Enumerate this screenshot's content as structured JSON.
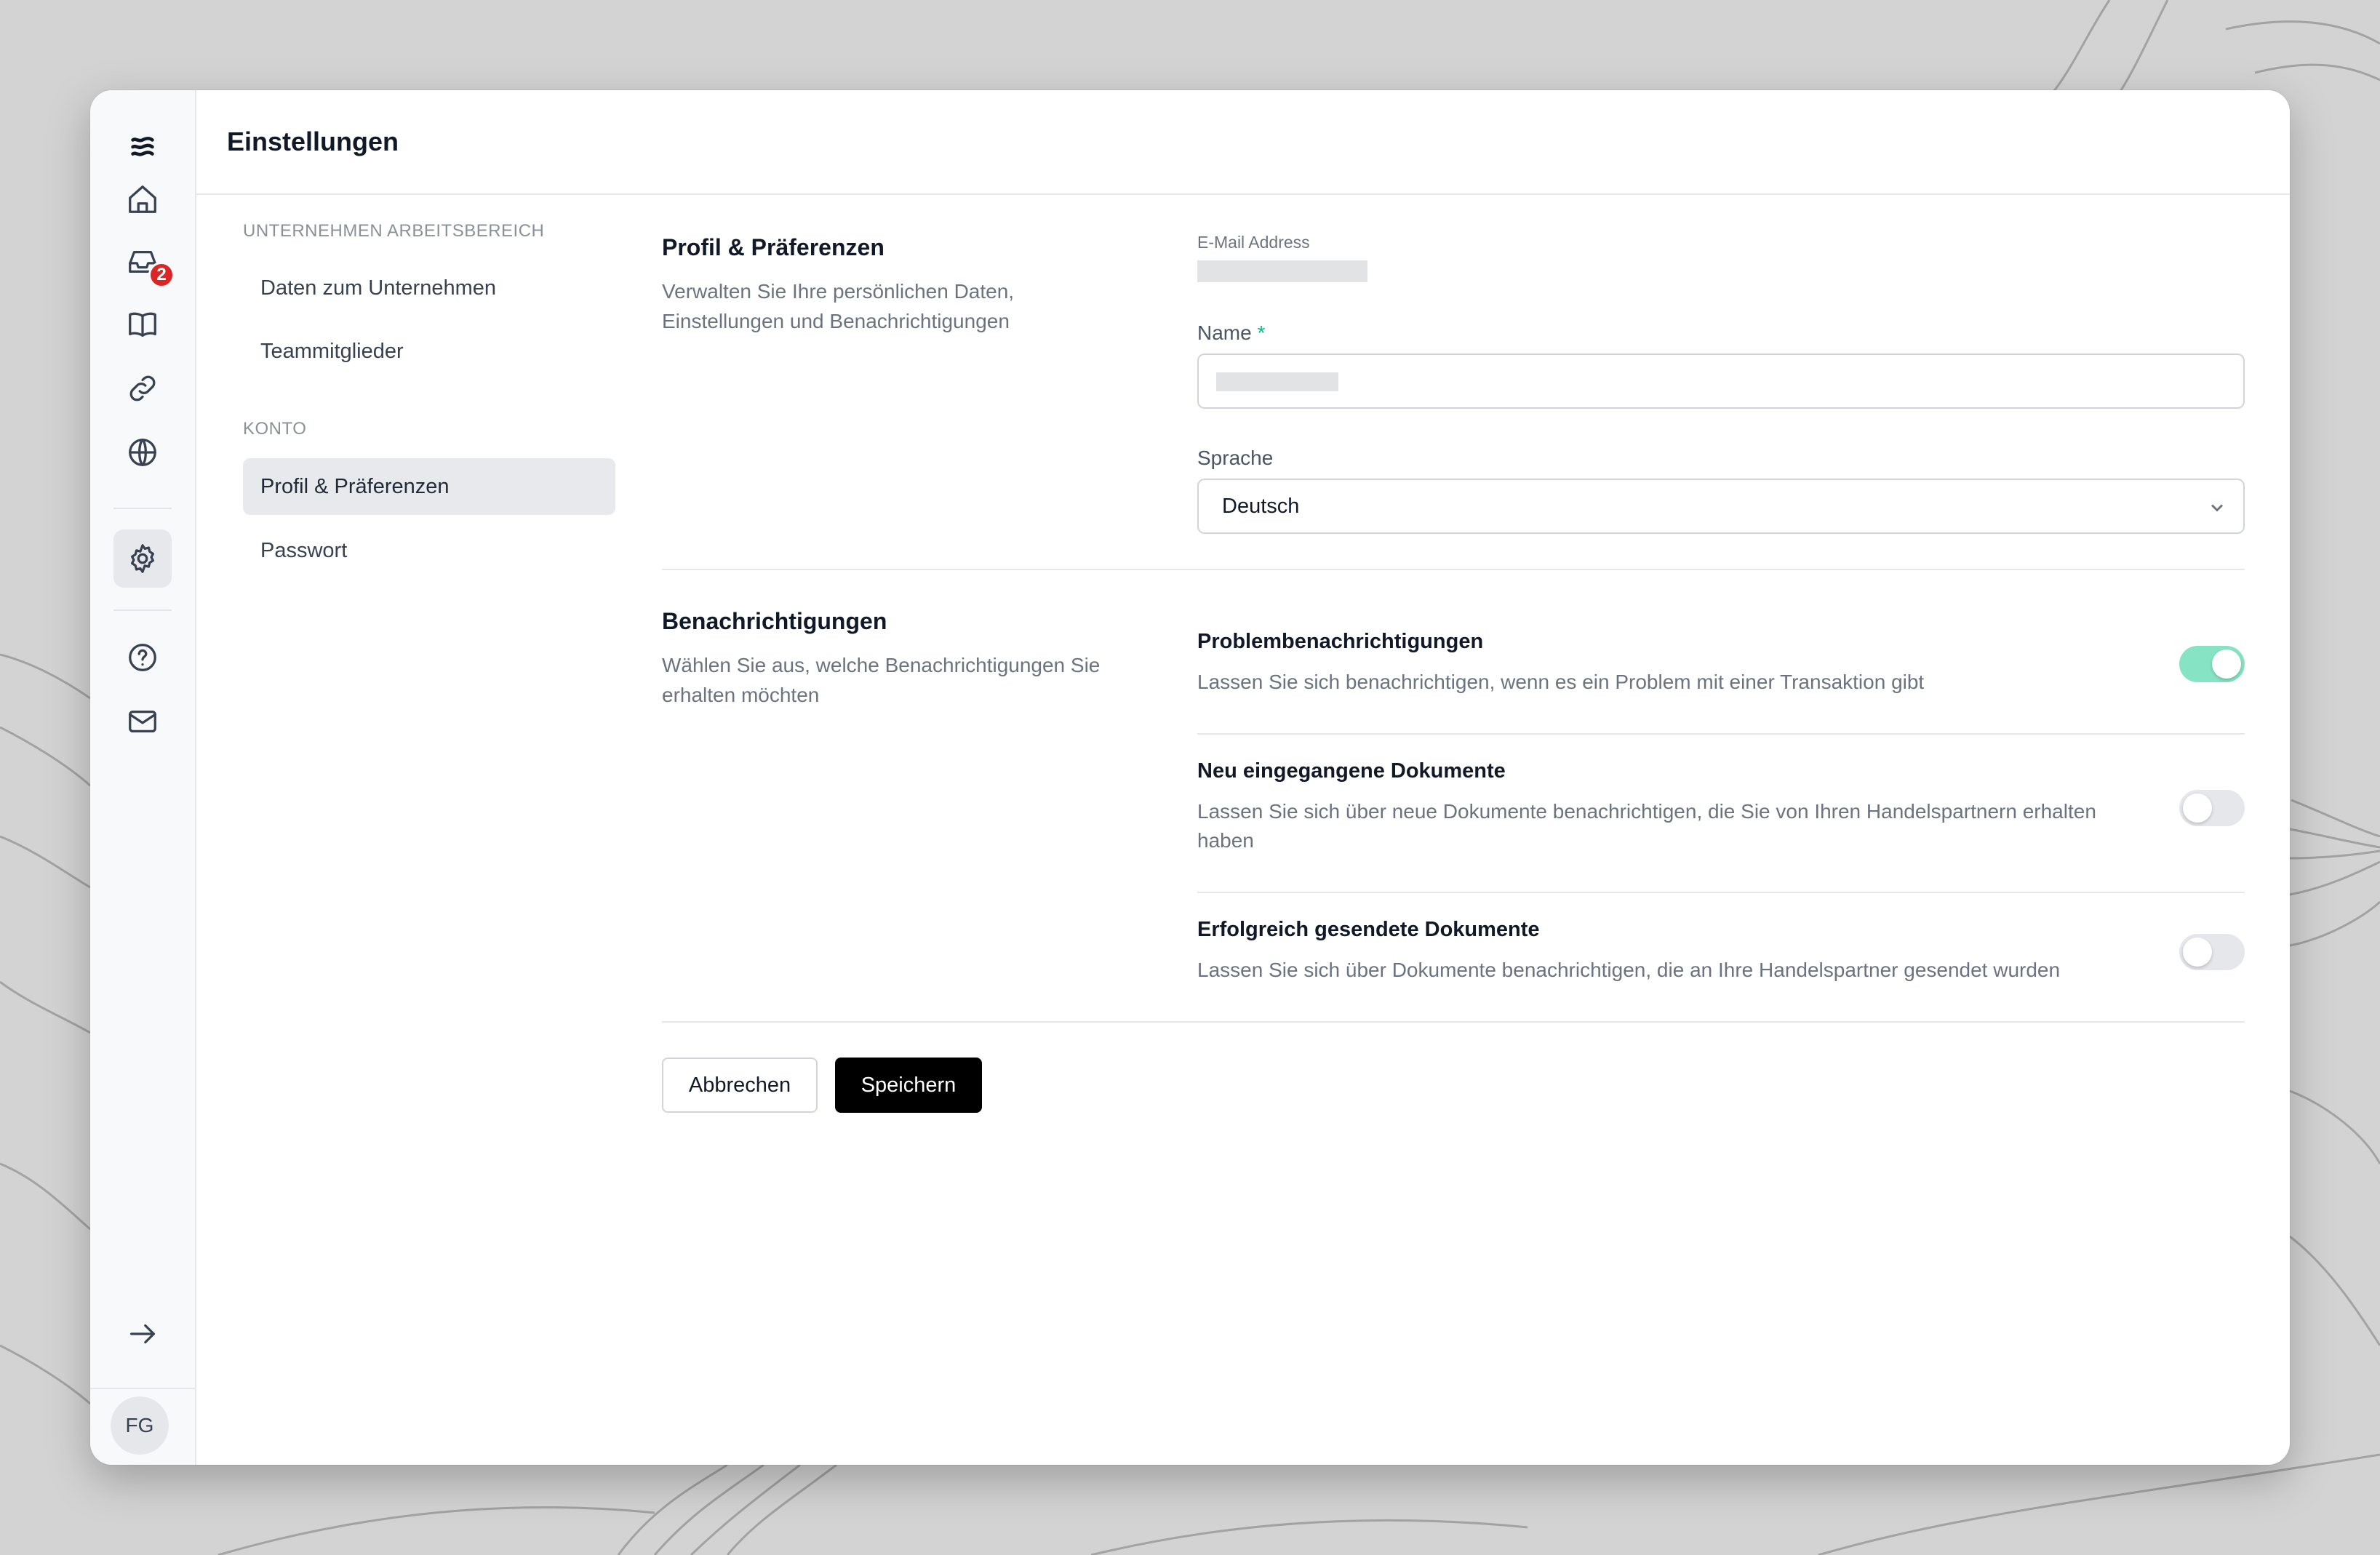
{
  "app": {
    "page_title": "Einstellungen",
    "user_initials": "FG",
    "inbox_badge": "2"
  },
  "rail": {
    "icons": [
      "logo-icon",
      "home-icon",
      "inbox-icon",
      "book-icon",
      "link-icon",
      "globe-icon",
      "gear-icon",
      "help-icon",
      "mail-icon",
      "arrow-right-icon"
    ]
  },
  "settings_nav": {
    "section_workspace": "UNTERNEHMEN ARBEITSBEREICH",
    "item_company": "Daten zum Unternehmen",
    "item_team": "Teammitglieder",
    "section_account": "KONTO",
    "item_profile": "Profil & Präferenzen",
    "item_password": "Passwort"
  },
  "profile": {
    "title": "Profil & Präferenzen",
    "description": "Verwalten Sie Ihre persönlichen Daten, Einstellungen und Benachrichtigungen",
    "email_label": "E-Mail Address",
    "name_label": "Name",
    "required_marker": "*",
    "language_label": "Sprache",
    "language_value": "Deutsch"
  },
  "notifications": {
    "title": "Benachrichtigungen",
    "description": "Wählen Sie aus, welche Benachrichtigungen Sie erhalten möchten",
    "items": [
      {
        "title": "Problembenachrichtigungen",
        "desc": "Lassen Sie sich benachrichtigen, wenn es ein Problem mit einer Transaktion gibt",
        "enabled": true
      },
      {
        "title": "Neu eingegangene Dokumente",
        "desc": "Lassen Sie sich über neue Dokumente benachrichtigen, die Sie von Ihren Handelspartnern erhalten haben",
        "enabled": false
      },
      {
        "title": "Erfolgreich gesendete Dokumente",
        "desc": "Lassen Sie sich über Dokumente benachrichtigen, die an Ihre Handelspartner gesendet wurden",
        "enabled": false
      }
    ]
  },
  "actions": {
    "cancel": "Abbrechen",
    "save": "Speichern"
  },
  "colors": {
    "background": "#d3d3d3",
    "toggle_on": "#86e3c4",
    "badge": "#dc2626",
    "primary_button": "#000000",
    "required": "#10b981"
  }
}
